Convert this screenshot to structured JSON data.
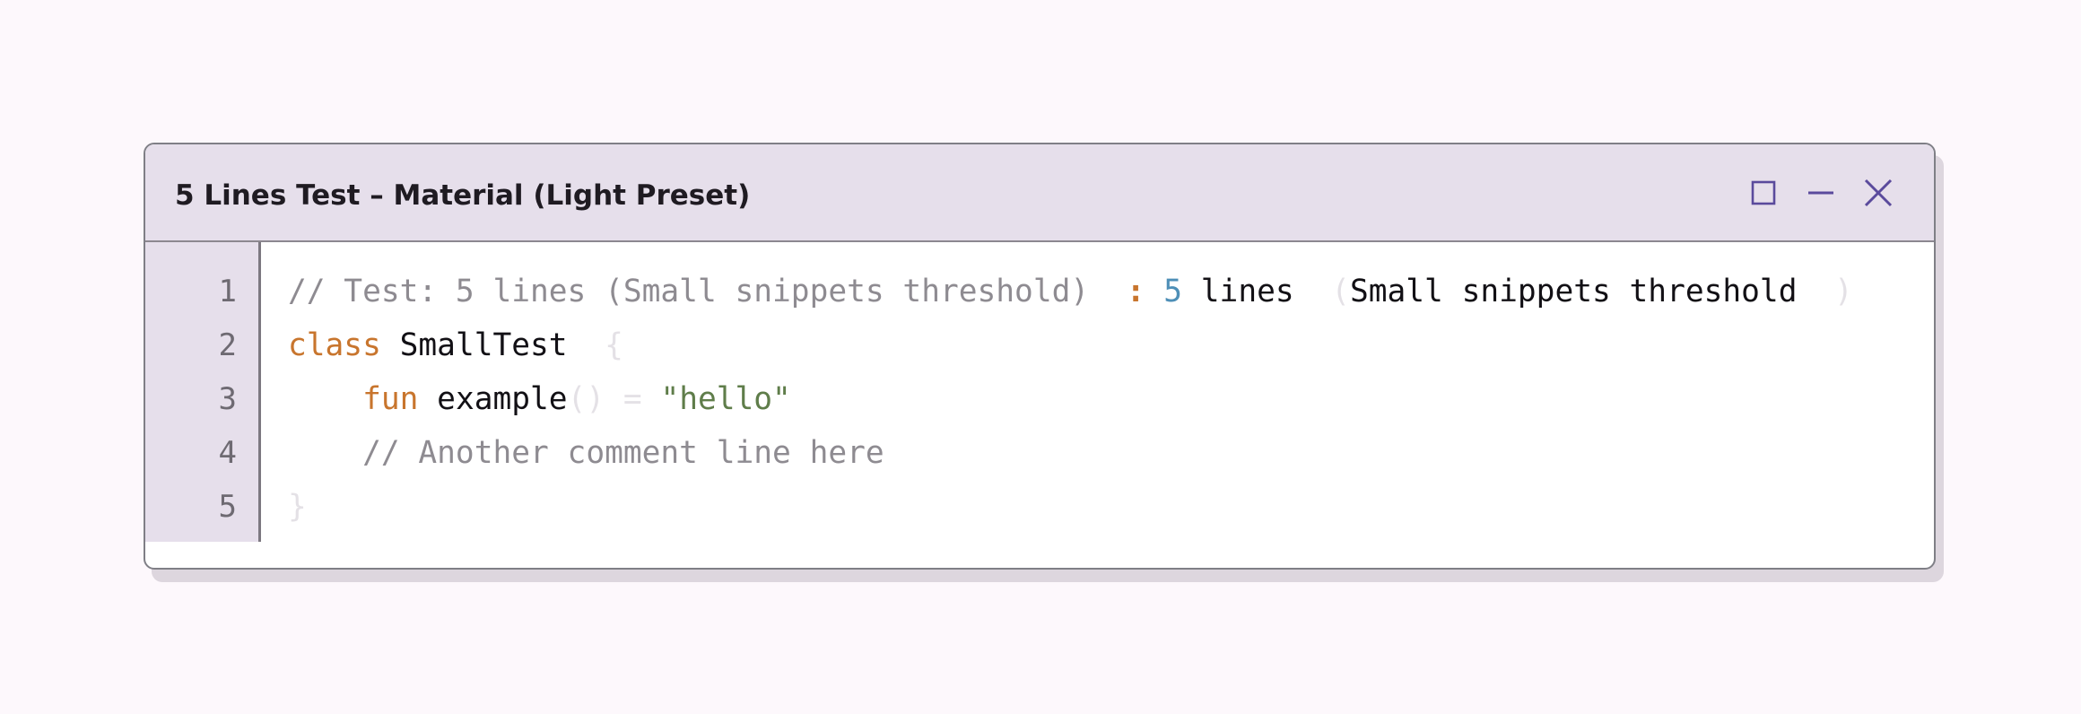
{
  "window": {
    "title": "5 Lines Test – Material (Light Preset)",
    "controls": {
      "maximize_icon": "square-icon",
      "minimize_icon": "minus-icon",
      "close_icon": "close-x-icon"
    },
    "accent_color": "#5a4a9c"
  },
  "editor": {
    "line_numbers": [
      "1",
      "2",
      "3",
      "4",
      "5"
    ],
    "lines": [
      [
        {
          "type": "comment",
          "text": "// Test: 5 lines (Small snippets threshold)  "
        },
        {
          "type": "colon",
          "text": ": "
        },
        {
          "type": "number",
          "text": "5"
        },
        {
          "type": "ident",
          "text": " lines  "
        },
        {
          "type": "punct",
          "text": "("
        },
        {
          "type": "ident",
          "text": "Small snippets threshold  "
        },
        {
          "type": "punct",
          "text": ")"
        }
      ],
      [
        {
          "type": "keyword",
          "text": "class"
        },
        {
          "type": "ident",
          "text": " SmallTest  "
        },
        {
          "type": "punct",
          "text": "{"
        }
      ],
      [
        {
          "type": "ident",
          "text": "    "
        },
        {
          "type": "keyword",
          "text": "fun"
        },
        {
          "type": "ident",
          "text": " example"
        },
        {
          "type": "punct",
          "text": "() = "
        },
        {
          "type": "string",
          "text": "\"hello\""
        }
      ],
      [
        {
          "type": "comment",
          "text": "    // Another comment line here"
        }
      ],
      [
        {
          "type": "punct",
          "text": "}"
        }
      ]
    ]
  }
}
